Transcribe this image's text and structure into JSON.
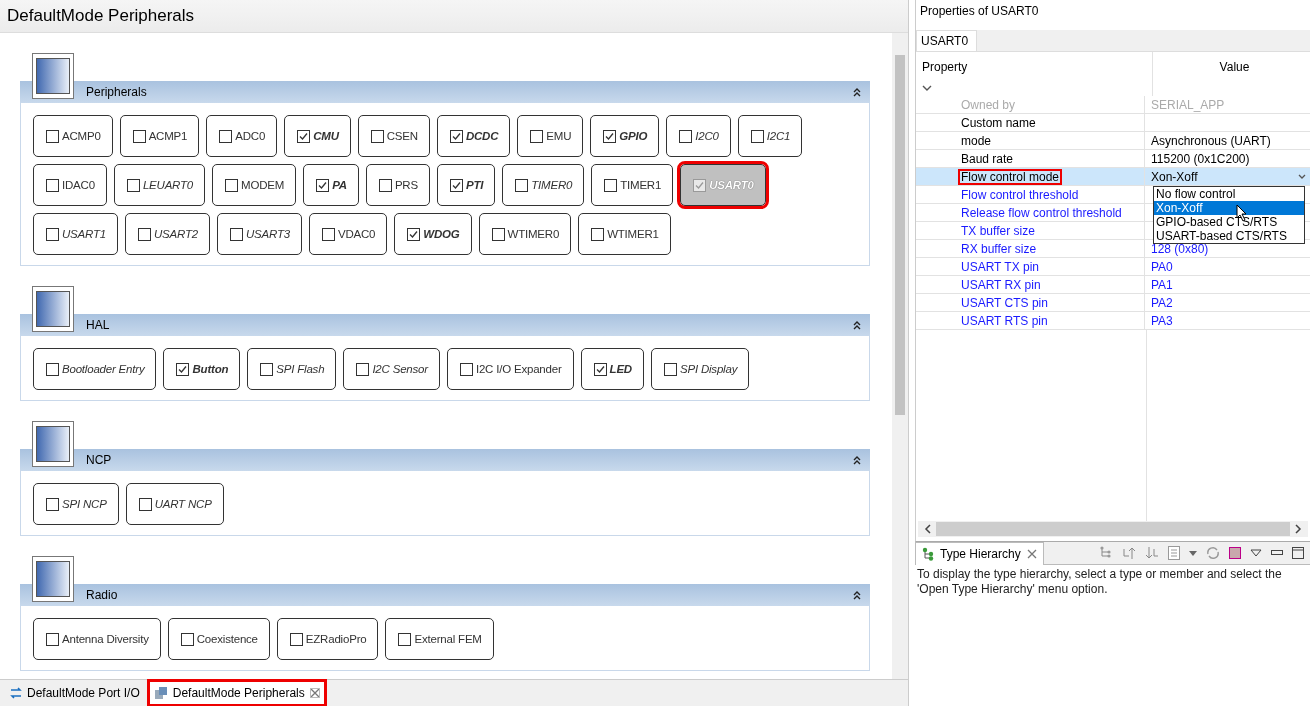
{
  "editor": {
    "title": "DefaultMode Peripherals",
    "sections": [
      {
        "title": "Peripherals",
        "items": [
          {
            "label": "ACMP0",
            "checked": false,
            "italic": false,
            "selected": false,
            "highlighted": false
          },
          {
            "label": "ACMP1",
            "checked": false,
            "italic": false,
            "selected": false,
            "highlighted": false
          },
          {
            "label": "ADC0",
            "checked": false,
            "italic": false,
            "selected": false,
            "highlighted": false
          },
          {
            "label": "CMU",
            "checked": true,
            "italic": true,
            "selected": false,
            "highlighted": false
          },
          {
            "label": "CSEN",
            "checked": false,
            "italic": false,
            "selected": false,
            "highlighted": false
          },
          {
            "label": "DCDC",
            "checked": true,
            "italic": true,
            "selected": false,
            "highlighted": false
          },
          {
            "label": "EMU",
            "checked": false,
            "italic": false,
            "selected": false,
            "highlighted": false
          },
          {
            "label": "GPIO",
            "checked": true,
            "italic": true,
            "selected": false,
            "highlighted": false
          },
          {
            "label": "I2C0",
            "checked": false,
            "italic": true,
            "selected": false,
            "highlighted": false
          },
          {
            "label": "I2C1",
            "checked": false,
            "italic": true,
            "selected": false,
            "highlighted": false
          },
          {
            "label": "IDAC0",
            "checked": false,
            "italic": false,
            "selected": false,
            "highlighted": false
          },
          {
            "label": "LEUART0",
            "checked": false,
            "italic": true,
            "selected": false,
            "highlighted": false
          },
          {
            "label": "MODEM",
            "checked": false,
            "italic": false,
            "selected": false,
            "highlighted": false
          },
          {
            "label": "PA",
            "checked": true,
            "italic": true,
            "selected": false,
            "highlighted": false
          },
          {
            "label": "PRS",
            "checked": false,
            "italic": false,
            "selected": false,
            "highlighted": false
          },
          {
            "label": "PTI",
            "checked": true,
            "italic": true,
            "selected": false,
            "highlighted": false
          },
          {
            "label": "TIMER0",
            "checked": false,
            "italic": true,
            "selected": false,
            "highlighted": false
          },
          {
            "label": "TIMER1",
            "checked": false,
            "italic": false,
            "selected": false,
            "highlighted": false
          },
          {
            "label": "USART0",
            "checked": true,
            "italic": true,
            "selected": true,
            "highlighted": true
          },
          {
            "label": "USART1",
            "checked": false,
            "italic": true,
            "selected": false,
            "highlighted": false
          },
          {
            "label": "USART2",
            "checked": false,
            "italic": true,
            "selected": false,
            "highlighted": false
          },
          {
            "label": "USART3",
            "checked": false,
            "italic": true,
            "selected": false,
            "highlighted": false
          },
          {
            "label": "VDAC0",
            "checked": false,
            "italic": false,
            "selected": false,
            "highlighted": false
          },
          {
            "label": "WDOG",
            "checked": true,
            "italic": true,
            "selected": false,
            "highlighted": false
          },
          {
            "label": "WTIMER0",
            "checked": false,
            "italic": false,
            "selected": false,
            "highlighted": false
          },
          {
            "label": "WTIMER1",
            "checked": false,
            "italic": false,
            "selected": false,
            "highlighted": false
          }
        ]
      },
      {
        "title": "HAL",
        "items": [
          {
            "label": "Bootloader Entry",
            "checked": false,
            "italic": true,
            "selected": false,
            "highlighted": false
          },
          {
            "label": "Button",
            "checked": true,
            "italic": true,
            "selected": false,
            "highlighted": false
          },
          {
            "label": "SPI Flash",
            "checked": false,
            "italic": true,
            "selected": false,
            "highlighted": false
          },
          {
            "label": "I2C Sensor",
            "checked": false,
            "italic": true,
            "selected": false,
            "highlighted": false
          },
          {
            "label": "I2C I/O Expander",
            "checked": false,
            "italic": false,
            "selected": false,
            "highlighted": false
          },
          {
            "label": "LED",
            "checked": true,
            "italic": true,
            "selected": false,
            "highlighted": false
          },
          {
            "label": "SPI Display",
            "checked": false,
            "italic": true,
            "selected": false,
            "highlighted": false
          }
        ]
      },
      {
        "title": "NCP",
        "items": [
          {
            "label": "SPI NCP",
            "checked": false,
            "italic": true,
            "selected": false,
            "highlighted": false
          },
          {
            "label": "UART NCP",
            "checked": false,
            "italic": true,
            "selected": false,
            "highlighted": false
          }
        ]
      },
      {
        "title": "Radio",
        "items": [
          {
            "label": "Antenna Diversity",
            "checked": false,
            "italic": false,
            "selected": false,
            "highlighted": false
          },
          {
            "label": "Coexistence",
            "checked": false,
            "italic": false,
            "selected": false,
            "highlighted": false
          },
          {
            "label": "EZRadioPro",
            "checked": false,
            "italic": false,
            "selected": false,
            "highlighted": false
          },
          {
            "label": "External FEM",
            "checked": false,
            "italic": false,
            "selected": false,
            "highlighted": false
          }
        ]
      }
    ]
  },
  "bottom_tabs": [
    {
      "label": "DefaultMode Port I/O",
      "selected": false,
      "highlighted": false
    },
    {
      "label": "DefaultMode Peripherals",
      "selected": true,
      "highlighted": true
    }
  ],
  "properties": {
    "title": "Properties of USART0",
    "tab": "USART0",
    "columns": [
      "Property",
      "Value"
    ],
    "rows": [
      {
        "name": "Owned by",
        "value": "SERIAL_APP",
        "kind": "disabled",
        "selected": false,
        "highlighted": false
      },
      {
        "name": "Custom name",
        "kind": "normal",
        "selected": false,
        "highlighted": false
      },
      {
        "name": "mode",
        "value": "Asynchronous (UART)",
        "kind": "normal",
        "selected": false,
        "highlighted": false
      },
      {
        "name": "Baud rate",
        "value": "115200 (0x1C200)",
        "kind": "normal",
        "selected": false,
        "highlighted": false
      },
      {
        "name": "Flow control mode",
        "value": "Xon-Xoff",
        "kind": "normal",
        "selected": true,
        "highlighted": true
      },
      {
        "name": "Flow control threshold",
        "kind": "link",
        "selected": false,
        "highlighted": false
      },
      {
        "name": "Release flow control threshold",
        "kind": "link",
        "selected": false,
        "highlighted": false
      },
      {
        "name": "TX buffer size",
        "kind": "link",
        "selected": false,
        "highlighted": false
      },
      {
        "name": "RX buffer size",
        "value": "128 (0x80)",
        "kind": "link",
        "selected": false,
        "highlighted": false
      },
      {
        "name": "USART TX pin",
        "value": "PA0",
        "kind": "link",
        "selected": false,
        "highlighted": false
      },
      {
        "name": "USART RX pin",
        "value": "PA1",
        "kind": "link",
        "selected": false,
        "highlighted": false
      },
      {
        "name": "USART CTS pin",
        "value": "PA2",
        "kind": "link",
        "selected": false,
        "highlighted": false
      },
      {
        "name": "USART RTS pin",
        "value": "PA3",
        "kind": "link",
        "selected": false,
        "highlighted": false
      }
    ],
    "dropdown": {
      "options": [
        {
          "label": "No flow control",
          "selected": false
        },
        {
          "label": "Xon-Xoff",
          "selected": true
        },
        {
          "label": "GPIO-based CTS/RTS",
          "selected": false
        },
        {
          "label": "USART-based CTS/RTS",
          "selected": false
        }
      ]
    }
  },
  "type_hierarchy": {
    "tab": "Type Hierarchy",
    "message": "To display the type hierarchy, select a type or member and select the 'Open Type Hierarchy' menu option."
  }
}
